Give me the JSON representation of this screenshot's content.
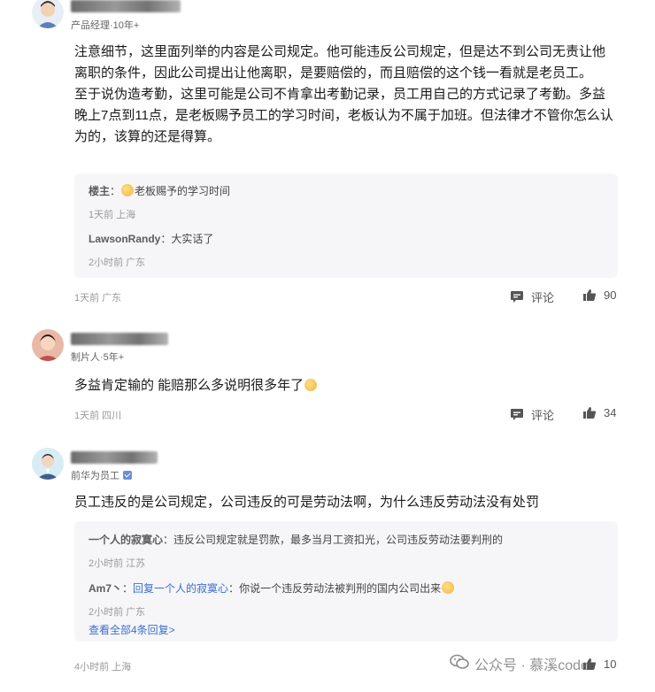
{
  "comments": [
    {
      "meta_role": "产品经理·10年+",
      "paragraphs": [
        "注意细节，这里面列举的内容是公司规定。他可能违反公司规定，但是达不到公司无责让他离职的条件，因此公司提出让他离职，是要赔偿的，而且赔偿的这个钱一看就是老员工。",
        "至于说伪造考勤，这里可能是公司不肯拿出考勤记录，员工用自己的方式记录了考勤。多益晚上7点到11点，是老板赐予员工的学习时间，老板认为不属于加班。但法律才不管你怎么认为的，该算的还是得算。"
      ],
      "replies": [
        {
          "name": "楼主",
          "sep": "：",
          "text": "老板赐予的学习时间",
          "meta": "1天前 上海"
        },
        {
          "name": "LawsonRandy",
          "sep": "：",
          "text": "大实话了",
          "meta": "2小时前 广东"
        }
      ],
      "footer": "1天前 广东",
      "comment_label": "评论",
      "likes": "90"
    },
    {
      "meta_role": "制片人·5年+",
      "paragraphs": [
        "多益肯定输的 能赔那么多说明很多年了"
      ],
      "replies": [],
      "footer": "1天前 四川",
      "comment_label": "评论",
      "likes": "34"
    },
    {
      "meta_role": "前华为员工",
      "paragraphs": [
        "员工违反的是公司规定，公司违反的可是劳动法啊，为什么违反劳动法没有处罚"
      ],
      "replies": [
        {
          "name": "一个人的寂寞心",
          "sep": "：",
          "text": "违反公司规定就是罚款，最多当月工资扣光，公司违反劳动法要判刑的",
          "meta": "2小时前 江苏"
        },
        {
          "name": "Am7丶",
          "sep": "：",
          "reply_to": "回复一个人的寂寞心",
          "text": "你说一个违反劳动法被判刑的国内公司出来",
          "meta": "2小时前 广东"
        }
      ],
      "view_all": "查看全部4条回复>",
      "footer": "4小时前 上海",
      "comment_label": "评论",
      "likes": "10"
    }
  ],
  "watermark": "公众号 · 慕溪code",
  "icons": {
    "comment": "comment-bubble-icon",
    "like": "thumbs-up-icon",
    "verify": "verified-badge-icon",
    "wechat": "wechat-icon"
  },
  "colors": {
    "link": "#3b6ed1",
    "reply_bg": "#f6f6f8",
    "meta": "#9a9a9a"
  }
}
